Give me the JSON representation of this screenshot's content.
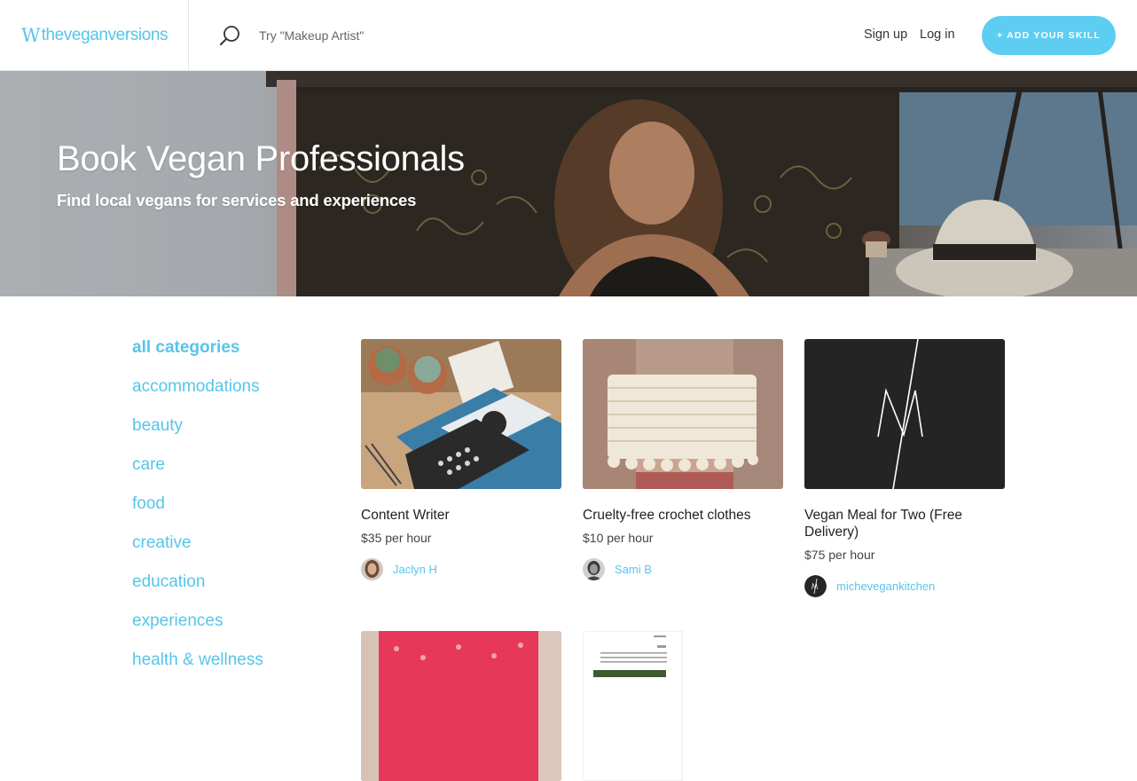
{
  "header": {
    "logo_mark": "W",
    "logo_text": "theveganversions",
    "search_placeholder": "Try \"Makeup Artist\"",
    "signup_label": "Sign up",
    "login_label": "Log in",
    "add_skill_label": "+ ADD YOUR SKILL"
  },
  "hero": {
    "title": "Book Vegan Professionals",
    "subtitle": "Find local vegans for services and experiences"
  },
  "categories": [
    {
      "label": "all categories",
      "active": true
    },
    {
      "label": "accommodations"
    },
    {
      "label": "beauty"
    },
    {
      "label": "care"
    },
    {
      "label": "food"
    },
    {
      "label": "creative"
    },
    {
      "label": "education"
    },
    {
      "label": "experiences"
    },
    {
      "label": "health & wellness"
    }
  ],
  "listings": [
    {
      "title": "Content Writer",
      "price": "$35 per hour",
      "owner": "Jaclyn H"
    },
    {
      "title": "Cruelty-free crochet clothes",
      "price": "$10 per hour",
      "owner": "Sami B"
    },
    {
      "title": "Vegan Meal for Two (Free Delivery)",
      "price": "$75 per hour",
      "owner": "michevegankitchen"
    }
  ],
  "colors": {
    "accent": "#56c5ea",
    "button": "#5ecdf2"
  }
}
